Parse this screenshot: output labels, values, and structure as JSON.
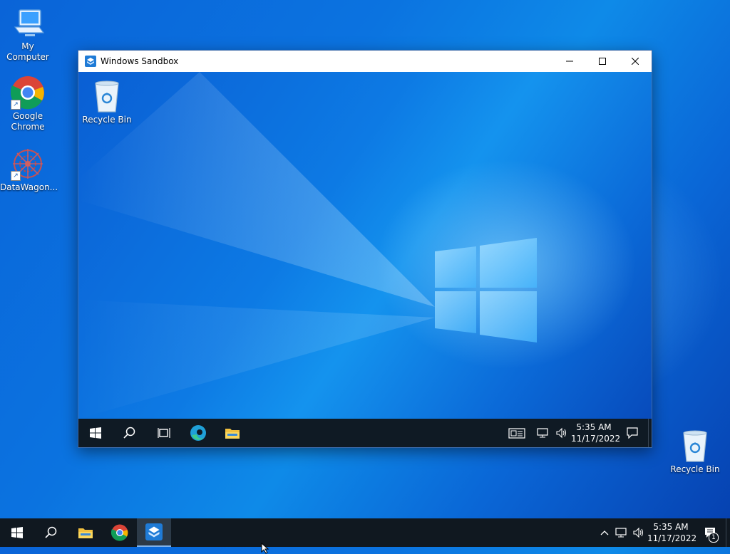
{
  "desktop": {
    "icons": [
      {
        "label": "My Computer"
      },
      {
        "label": "Google\nChrome"
      },
      {
        "label": "DataWagon..."
      },
      {
        "label": "Recycle Bin"
      }
    ]
  },
  "sandbox_window": {
    "title": "Windows Sandbox",
    "inner_desktop": {
      "recycle_label": "Recycle Bin"
    },
    "inner_taskbar": {
      "time": "5:35 AM",
      "date": "11/17/2022"
    }
  },
  "host_taskbar": {
    "time": "5:35 AM",
    "date": "11/17/2022",
    "notification_count": "1"
  },
  "colors": {
    "accent": "#0078d7",
    "taskbar": "#101820"
  }
}
